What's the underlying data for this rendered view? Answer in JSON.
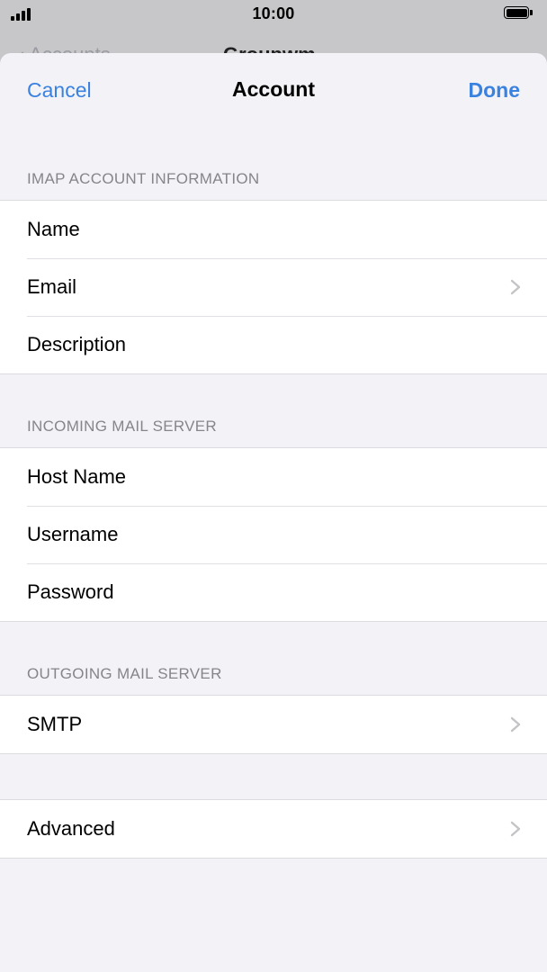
{
  "status_bar": {
    "time": "10:00"
  },
  "behind": {
    "back_label": "Accounts",
    "title": "Groupwm"
  },
  "nav": {
    "cancel_label": "Cancel",
    "title": "Account",
    "done_label": "Done"
  },
  "sections": [
    {
      "header": "IMAP ACCOUNT INFORMATION",
      "rows": [
        {
          "label": "Name",
          "chevron": false
        },
        {
          "label": "Email",
          "chevron": true
        },
        {
          "label": "Description",
          "chevron": false
        }
      ]
    },
    {
      "header": "INCOMING MAIL SERVER",
      "rows": [
        {
          "label": "Host Name",
          "chevron": false
        },
        {
          "label": "Username",
          "chevron": false
        },
        {
          "label": "Password",
          "chevron": false
        }
      ]
    },
    {
      "header": "OUTGOING MAIL SERVER",
      "rows": [
        {
          "label": "SMTP",
          "chevron": true
        }
      ]
    },
    {
      "header": "",
      "rows": [
        {
          "label": "Advanced",
          "chevron": true
        }
      ]
    }
  ],
  "colors": {
    "accent": "#3a82e0",
    "background": "#f2f2f7",
    "secondary_text": "#85858a"
  },
  "icons": {
    "signal": "cellular-signal-icon",
    "battery": "battery-icon",
    "chevron": "chevron-right-icon"
  }
}
